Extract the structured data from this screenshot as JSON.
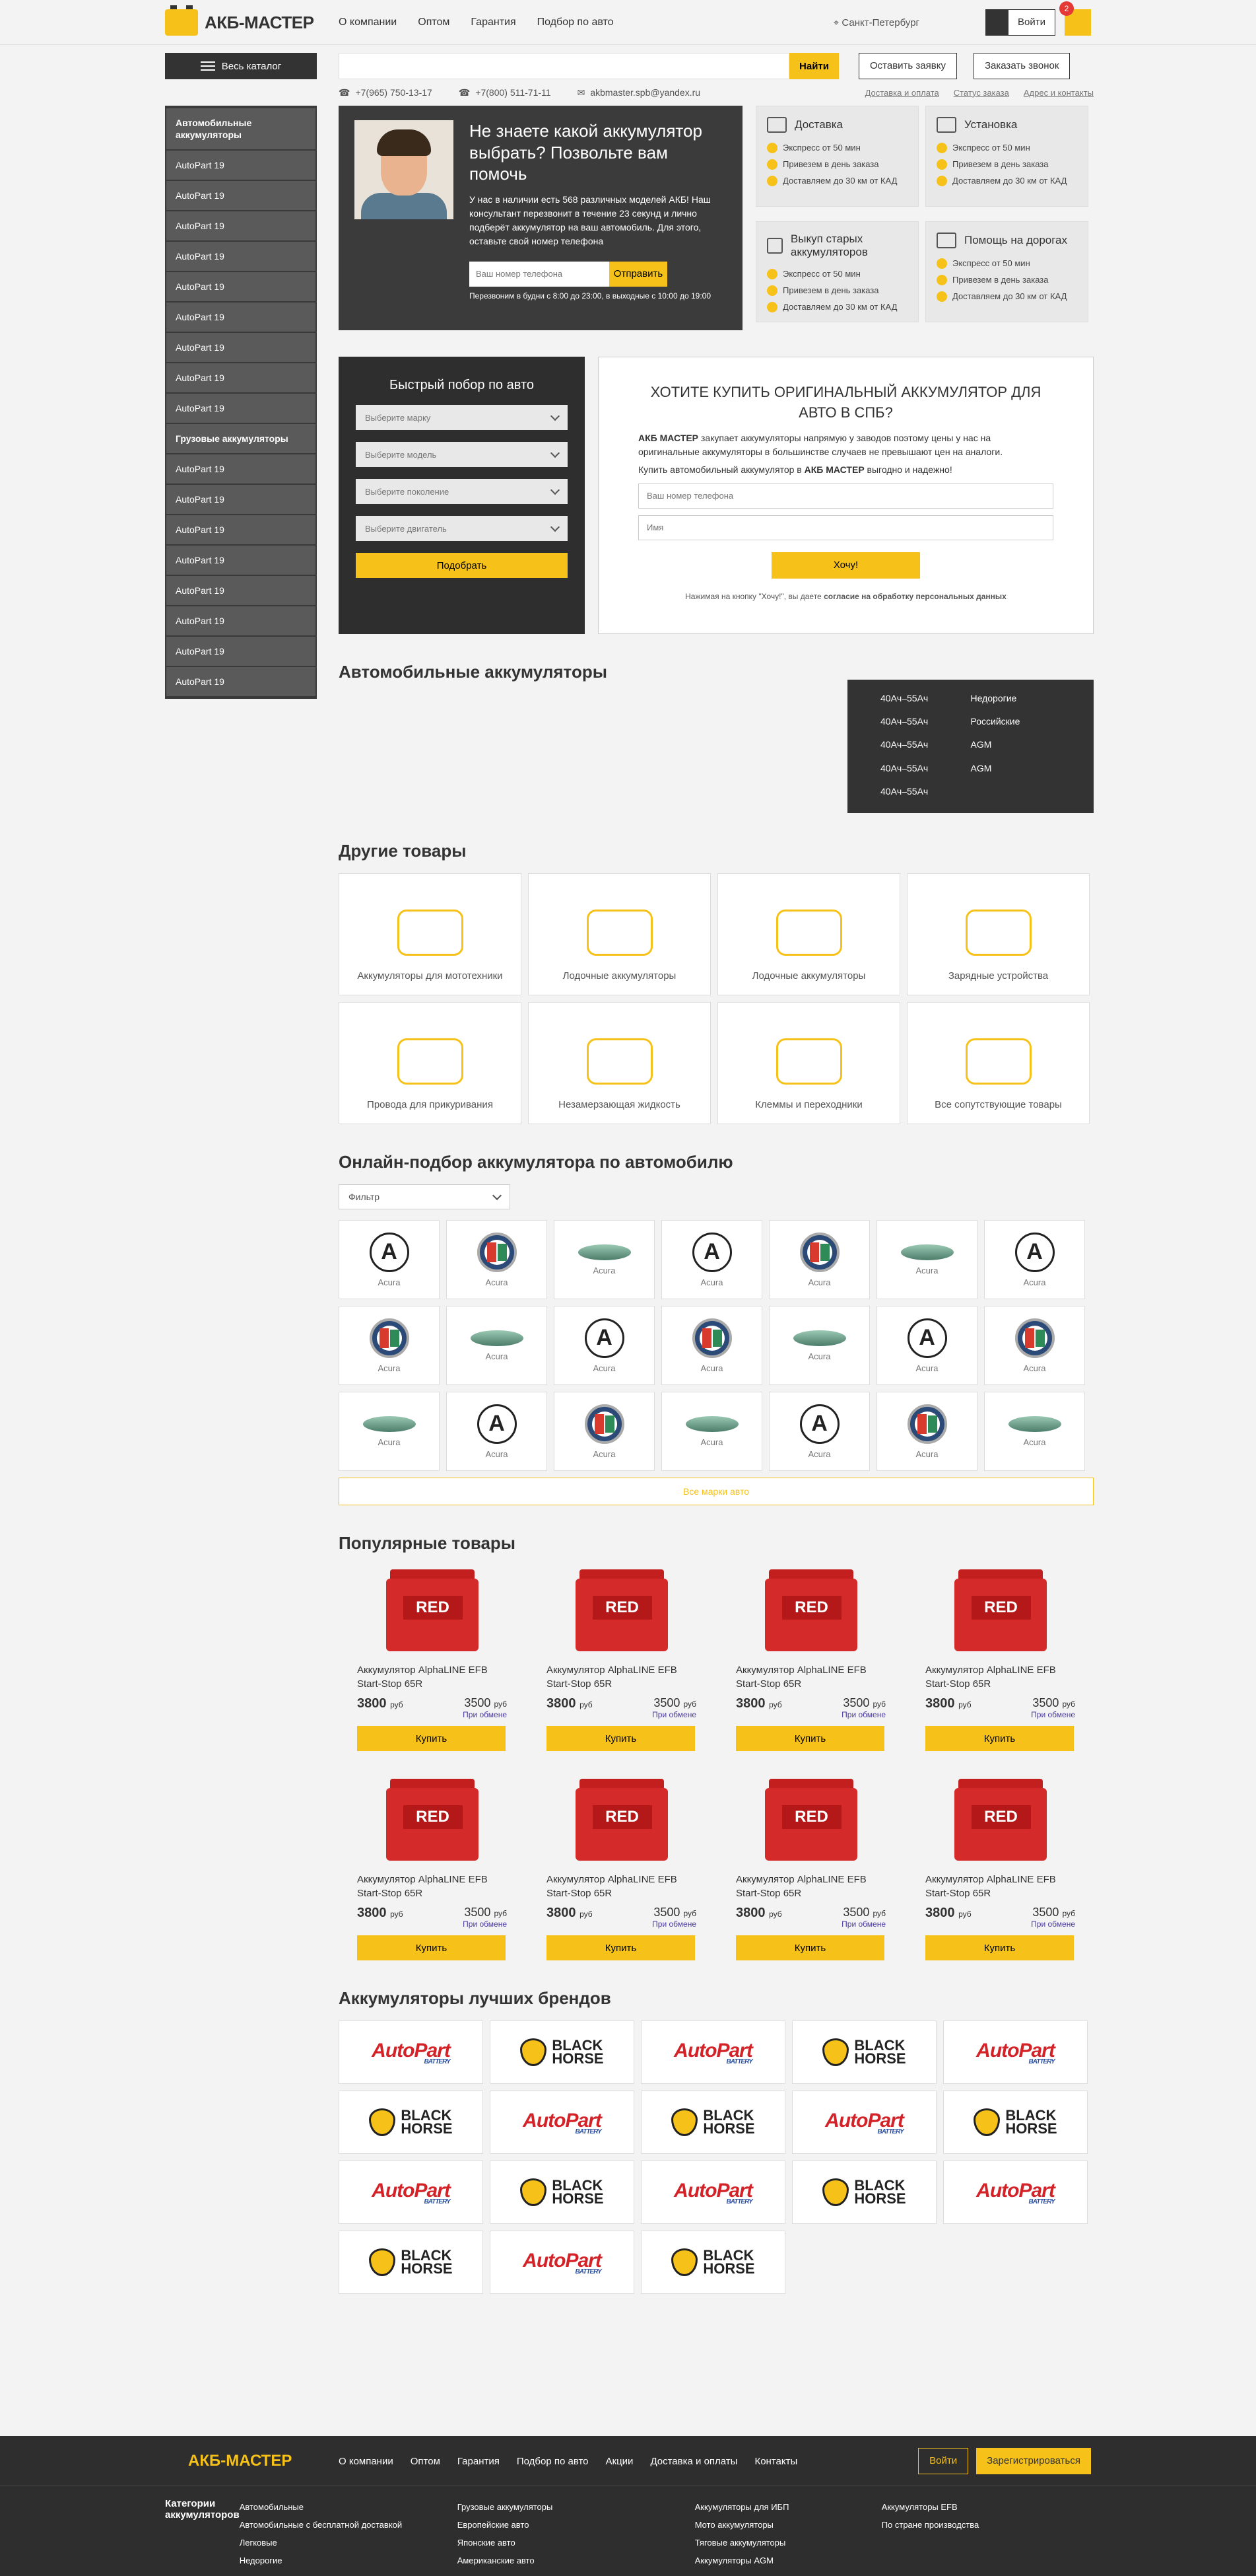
{
  "header": {
    "logo": "АКБ-МАСТЕР",
    "nav": [
      "О компании",
      "Оптом",
      "Гарантия",
      "Подбор по авто"
    ],
    "city": "Санкт-Петербург",
    "login": "Войти",
    "cart_count": "2"
  },
  "catalog": {
    "button": "Весь каталог",
    "items": [
      "Автомобильные аккумуляторы",
      "AutoPart 19",
      "AutoPart 19",
      "AutoPart 19",
      "AutoPart 19",
      "AutoPart 19",
      "AutoPart 19",
      "AutoPart 19",
      "AutoPart 19",
      "AutoPart 19",
      "Грузовые аккумуляторы",
      "AutoPart 19",
      "AutoPart 19",
      "AutoPart 19",
      "AutoPart 19",
      "AutoPart 19",
      "AutoPart 19",
      "AutoPart 19",
      "AutoPart 19"
    ]
  },
  "search": {
    "placeholder": "",
    "button": "Найти",
    "leave_request": "Оставить заявку",
    "order_call": "Заказать звонок"
  },
  "contacts": {
    "phone1": "+7(965) 750-13-17",
    "phone2": "+7(800) 511-71-11",
    "email": "akbmaster.spb@yandex.ru",
    "links": [
      "Доставка и оплата",
      "Статус заказа",
      "Адрес и контакты"
    ]
  },
  "hero": {
    "title": "Не знаете какой аккумулятор выбрать? Позвольте вам помочь",
    "text": "У нас в наличии есть 568 различных моделей АКБ! Наш консультант перезвонит в течение 23 секунд и лично подберёт аккумулятор на ваш автомобиль. Для этого, оставьте свой номер телефона",
    "phone_placeholder": "Ваш номер телефона",
    "send": "Отправить",
    "note": "Перезвоним в будни с 8:00 до 23:00, в выходные с 10:00 до 19:00"
  },
  "services": [
    {
      "title": "Доставка",
      "items": [
        "Экспресс от 50 мин",
        "Привезем в день заказа",
        "Доставляем до 30 км от КАД"
      ]
    },
    {
      "title": "Установка",
      "items": [
        "Экспресс от 50 мин",
        "Привезем в день заказа",
        "Доставляем до 30 км от КАД"
      ]
    },
    {
      "title": "Выкуп старых аккумуляторов",
      "items": [
        "Экспресс от 50 мин",
        "Привезем в день заказа",
        "Доставляем до 30 км от КАД"
      ]
    },
    {
      "title": "Помощь на дорогах",
      "items": [
        "Экспресс от 50 мин",
        "Привезем в день заказа",
        "Доставляем до 30 км от КАД"
      ]
    }
  ],
  "quick_pick": {
    "title": "Быстрый побор по авто",
    "selects": [
      "Выберите марку",
      "Выберите модель",
      "Выберите поколение",
      "Выберите двигатель"
    ],
    "button": "Подобрать"
  },
  "buy_form": {
    "title": "ХОТИТЕ КУПИТЬ ОРИГИНАЛЬНЫЙ АККУМУЛЯТОР ДЛЯ АВТО В СПБ?",
    "p1_strong": "АКБ МАСТЕР",
    "p1": " закупает аккумуляторы напрямую у заводов поэтому цены у нас на оригинальные аккумуляторы в большинстве случаев не превышают цен на аналоги.",
    "p2a": "Купить автомобильный аккумулятор в ",
    "p2_strong": "АКБ МАСТЕР",
    "p2b": " выгодно и надежно!",
    "phone_placeholder": "Ваш номер телефона",
    "name_placeholder": "Имя",
    "button": "Хочу!",
    "note_a": "Нажимая на кнопку \"Хочу!\", вы даете ",
    "note_b": "согласие на обработку персональных данных"
  },
  "auto_batteries": {
    "title": "Автомобильные аккумуляторы",
    "col1": [
      "40Ач–55Ач",
      "40Ач–55Ач",
      "40Ач–55Ач",
      "40Ач–55Ач",
      "40Ач–55Ач"
    ],
    "col2": [
      "Недорогие",
      "Российские",
      "AGM",
      "AGM"
    ]
  },
  "other_goods": {
    "title": "Другие товары",
    "items": [
      "Аккумуляторы для мототехники",
      "Лодочные аккумуляторы",
      "Лодочные аккумуляторы",
      "Зарядные устройства",
      "Провода для прикуривания",
      "Незамерзающая жидкость",
      "Клеммы и переходники",
      "Все сопутствующие товары"
    ]
  },
  "online_pick": {
    "title": "Онлайн-подбор аккумулятора по автомобилю",
    "filter": "Фильтр",
    "brand_label": "Acura",
    "all_brands": "Все марки авто"
  },
  "popular": {
    "title": "Популярные товары",
    "product_name": "Аккумулятор AlphaLINE EFB Start-Stop 65R",
    "price": "3800",
    "price_exchange": "3500",
    "currency": "руб",
    "exchange_note": "При обмене",
    "buy": "Купить",
    "label": "RED"
  },
  "best_brands": {
    "title": "Аккумуляторы лучших брендов",
    "autopart": "AutoPart",
    "autopart_sub": "BATTERY",
    "blackhorse1": "BLACK",
    "blackhorse2": "HORSE"
  },
  "footer": {
    "logo": "АКБ-МАСТЕР",
    "nav": [
      "О компании",
      "Оптом",
      "Гарантия",
      "Подбор по авто",
      "Акции",
      "Доставка и оплаты",
      "Контакты"
    ],
    "login": "Войти",
    "register": "Зарегистрироваться",
    "cat_title": "Категории аккумуляторов",
    "col1": [
      "Автомобильные",
      "Автомобильные с бесплатной доставкой",
      "Легковые",
      "Недорогие"
    ],
    "col2": [
      "Грузовые аккумуляторы",
      "Европейские авто",
      "Японские авто",
      "Американские авто"
    ],
    "col3": [
      "Аккумуляторы для ИБП",
      "Мото аккумуляторы",
      "Тяговые аккумуляторы",
      "Аккумуляторы AGM"
    ],
    "col4": [
      "Аккумуляторы EFB",
      "По стране производства"
    ]
  },
  "colors": {
    "accent": "#f6c21a",
    "dark": "#333333",
    "sidebar_item": "#5a5a5a"
  }
}
